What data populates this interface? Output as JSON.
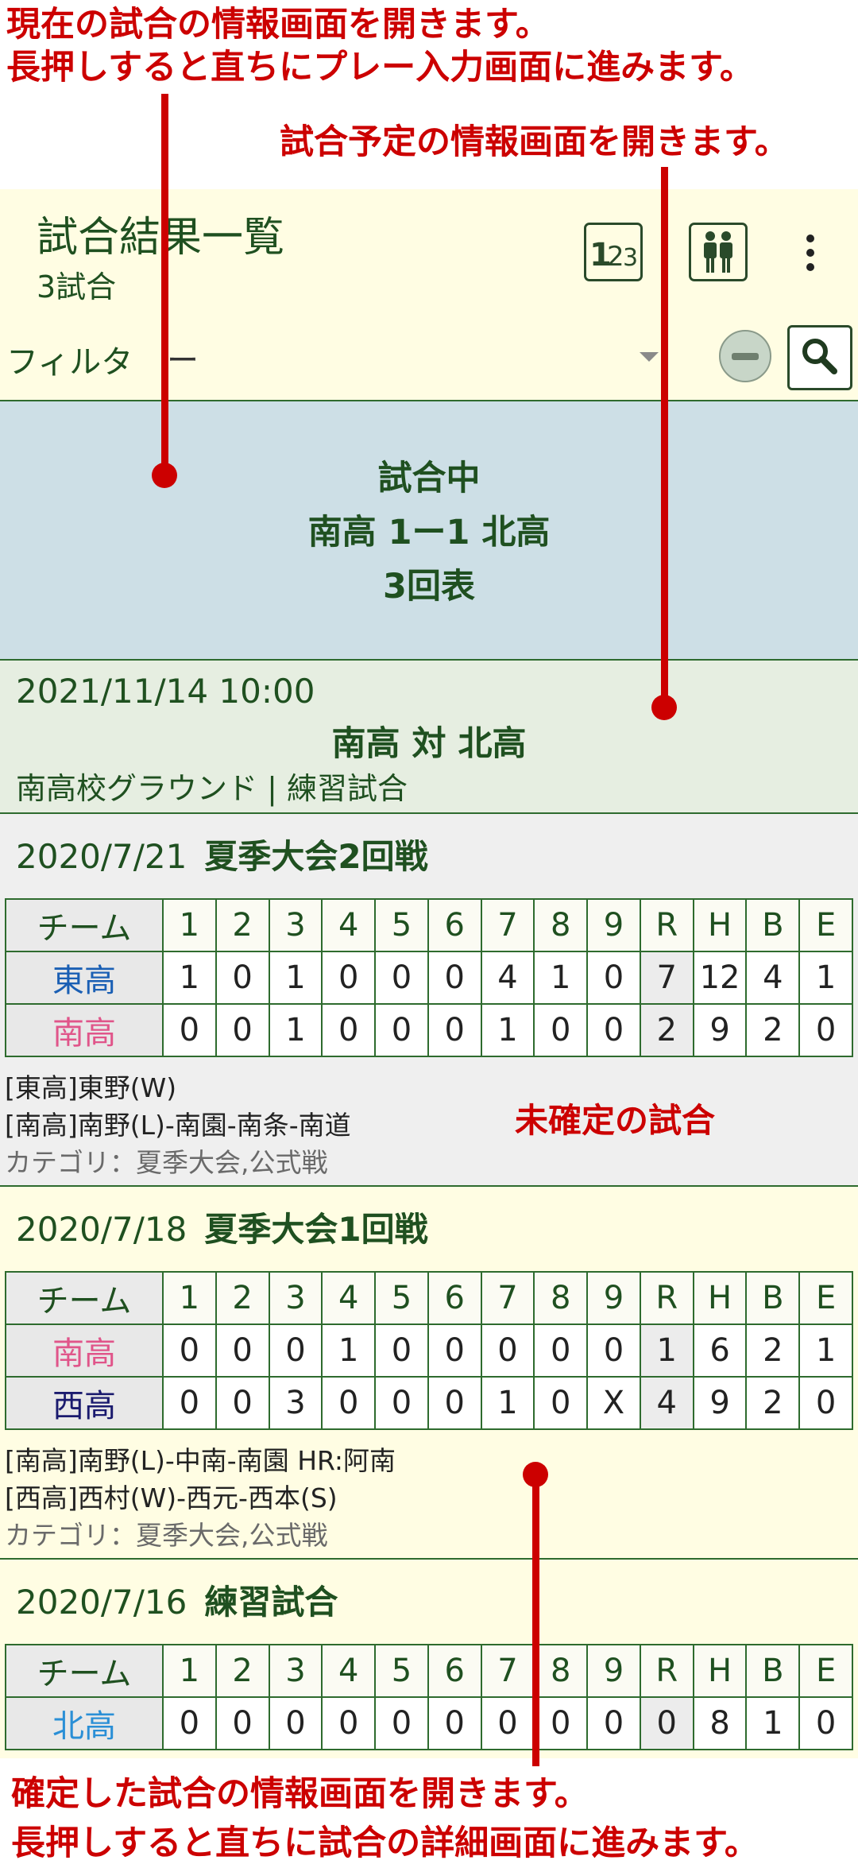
{
  "annotations": {
    "current_game_line1": "現在の試合の情報画面を開きます。",
    "current_game_line2": "長押しすると直ちにプレー入力画面に進みます。",
    "scheduled_game": "試合予定の情報画面を開きます。",
    "unconfirmed_game": "未確定の試合",
    "confirmed_game_line1": "確定した試合の情報画面を開きます。",
    "confirmed_game_line2": "長押しすると直ちに試合の詳細画面に進みます。",
    "color": "#cc0000"
  },
  "appbar": {
    "title": "試合結果一覧",
    "subtitle": "3試合",
    "icons": [
      "scoreboard-123-icon",
      "players-icon",
      "more-vert-icon"
    ]
  },
  "filter": {
    "label": "フィルタ",
    "value": "ー"
  },
  "current_game": {
    "status": "試合中",
    "score_line": "南高 1ー1 北高",
    "inning": "3回表"
  },
  "scheduled_game": {
    "datetime": "2021/11/14 10:00",
    "title": "南高 対 北高",
    "place": "南高校グラウンド | 練習試合"
  },
  "score_headers": [
    "チーム",
    "1",
    "2",
    "3",
    "4",
    "5",
    "6",
    "7",
    "8",
    "9",
    "R",
    "H",
    "B",
    "E"
  ],
  "games": [
    {
      "date": "2020/7/21",
      "name": "夏季大会2回戦",
      "rows": [
        {
          "team": "東高",
          "color": "#1a5fb4",
          "cells": [
            "1",
            "0",
            "1",
            "0",
            "0",
            "0",
            "4",
            "1",
            "0",
            "7",
            "12",
            "4",
            "1"
          ]
        },
        {
          "team": "南高",
          "color": "#e0558a",
          "cells": [
            "0",
            "0",
            "1",
            "0",
            "0",
            "0",
            "1",
            "0",
            "0",
            "2",
            "9",
            "2",
            "0"
          ]
        }
      ],
      "pitchers1": "[東高]東野(W)",
      "pitchers2": "[南高]南野(L)-南園-南条-南道",
      "category": "カテゴリ：夏季大会,公式戦",
      "background": "#efefef"
    },
    {
      "date": "2020/7/18",
      "name": "夏季大会1回戦",
      "rows": [
        {
          "team": "南高",
          "color": "#e0558a",
          "cells": [
            "0",
            "0",
            "0",
            "1",
            "0",
            "0",
            "0",
            "0",
            "0",
            "1",
            "6",
            "2",
            "1"
          ]
        },
        {
          "team": "西高",
          "color": "#1a1a6e",
          "cells": [
            "0",
            "0",
            "3",
            "0",
            "0",
            "0",
            "1",
            "0",
            "X",
            "4",
            "9",
            "2",
            "0"
          ]
        }
      ],
      "pitchers1": "[南高]南野(L)-中南-南園 HR:阿南",
      "pitchers2": "[西高]西村(W)-西元-西本(S)",
      "category": "カテゴリ：夏季大会,公式戦",
      "background": "#fffde3"
    },
    {
      "date": "2020/7/16",
      "name": "練習試合",
      "rows": [
        {
          "team": "北高",
          "color": "#2a8fd6",
          "cells": [
            "0",
            "0",
            "0",
            "0",
            "0",
            "0",
            "0",
            "0",
            "0",
            "0",
            "8",
            "1",
            "0"
          ]
        }
      ],
      "background": "#fffde3"
    }
  ]
}
